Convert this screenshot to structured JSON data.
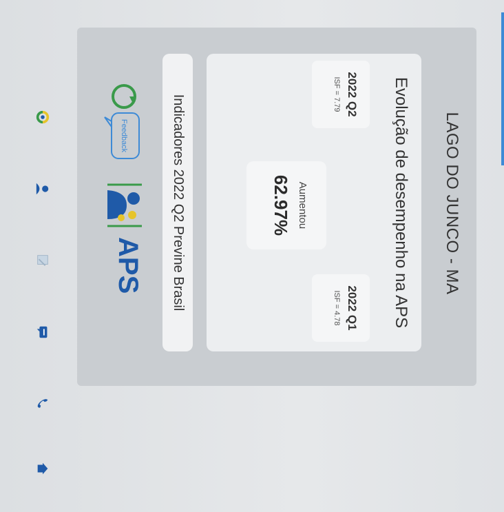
{
  "nav": {
    "icons": [
      "home-icon",
      "phone-icon",
      "message-icon",
      "edit-icon",
      "user-icon",
      "brand-icon"
    ]
  },
  "header": {
    "city": "LAGO DO JUNCO - MA"
  },
  "card": {
    "title": "Evolução de desempenho na APS",
    "q1": {
      "label": "2022 Q1",
      "isf": "ISF = 4.78"
    },
    "q2": {
      "label": "2022 Q2",
      "isf": "ISF = 7.79"
    },
    "trend": {
      "label": "Aumentou",
      "value": "62.97%"
    }
  },
  "indicators": {
    "text": "Indicadores 2022 Q2 Previne Brasil"
  },
  "logos": {
    "aps": "APS",
    "feedback": "Feedback"
  },
  "colors": {
    "accent": "#3d8ad6",
    "aps_blue": "#1f5aa8",
    "aps_yellow": "#e6c42b",
    "aps_green": "#3a9a4a"
  }
}
